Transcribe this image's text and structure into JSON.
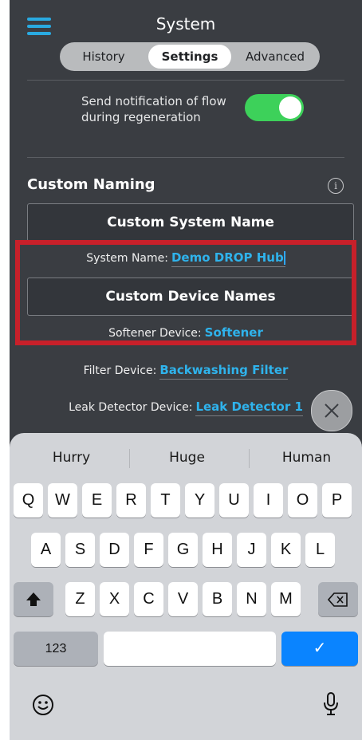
{
  "header": {
    "title": "System"
  },
  "tabs": [
    {
      "label": "History",
      "active": false
    },
    {
      "label": "Settings",
      "active": true
    },
    {
      "label": "Advanced",
      "active": false
    }
  ],
  "notification": {
    "text": "Send notification of flow during regeneration",
    "enabled": true
  },
  "custom_naming": {
    "title": "Custom Naming",
    "system_button": "Custom System Name",
    "system_label": "System Name:",
    "system_value": "Demo DROP Hub",
    "device_button": "Custom Device Names",
    "softener_label": "Softener Device:",
    "softener_value": "Softener",
    "filter_label": "Filter Device:",
    "filter_value": "Backwashing Filter",
    "leak_label": "Leak Detector Device:",
    "leak_value": "Leak Detector 1"
  },
  "keyboard": {
    "predictions": [
      "Hurry",
      "Huge",
      "Human"
    ],
    "row1": [
      "Q",
      "W",
      "E",
      "R",
      "T",
      "Y",
      "U",
      "I",
      "O",
      "P"
    ],
    "row2": [
      "A",
      "S",
      "D",
      "F",
      "G",
      "H",
      "J",
      "K",
      "L"
    ],
    "row3": [
      "Z",
      "X",
      "C",
      "V",
      "B",
      "N",
      "M"
    ],
    "numbers_key": "123",
    "done_key": "✓"
  },
  "colors": {
    "accent": "#2fb3ec",
    "toggle_on": "#3dd15a",
    "highlight": "#c8202a",
    "done_key": "#0a84ff"
  }
}
